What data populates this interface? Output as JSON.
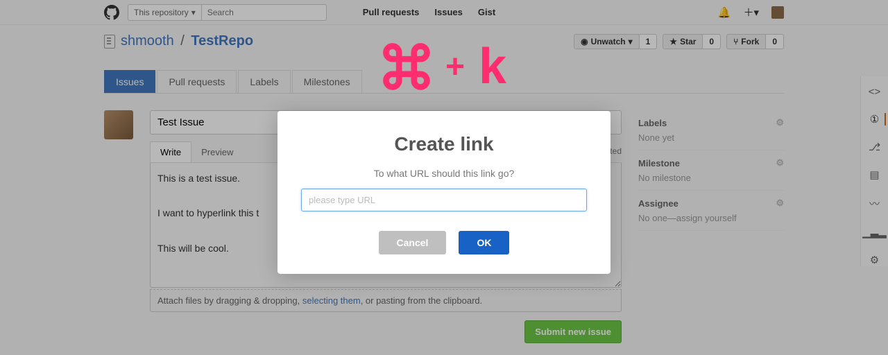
{
  "topbar": {
    "search_scope": "This repository",
    "search_placeholder": "Search",
    "nav": {
      "pulls": "Pull requests",
      "issues": "Issues",
      "gist": "Gist"
    }
  },
  "repo": {
    "owner": "shmooth",
    "sep": "/",
    "name": "TestRepo",
    "watch_label": "Unwatch",
    "watch_count": "1",
    "star_label": "Star",
    "star_count": "0",
    "fork_label": "Fork",
    "fork_count": "0"
  },
  "tabs": {
    "issues": "Issues",
    "pulls": "Pull requests",
    "labels": "Labels",
    "milestones": "Milestones"
  },
  "issue": {
    "title": "Test Issue",
    "write": "Write",
    "preview": "Preview",
    "imported": "mported",
    "body": "This is a test issue.\n\nI want to hyperlink this t\n\nThis will be cool.",
    "attach_pre": "Attach files by dragging & dropping, ",
    "attach_link": "selecting them",
    "attach_post": ", or pasting from the clipboard.",
    "submit": "Submit new issue"
  },
  "sidebar": {
    "labels_h": "Labels",
    "labels_v": "None yet",
    "milestone_h": "Milestone",
    "milestone_v": "No milestone",
    "assignee_h": "Assignee",
    "assignee_v": "No one—assign yourself"
  },
  "shortcut": {
    "plus": "+",
    "k": "k"
  },
  "modal": {
    "title": "Create link",
    "prompt": "To what URL should this link go?",
    "placeholder": "please type URL",
    "cancel": "Cancel",
    "ok": "OK"
  }
}
